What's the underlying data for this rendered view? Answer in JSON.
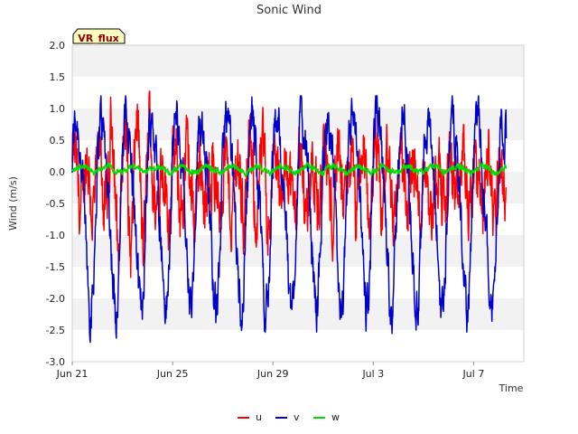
{
  "chart_data": {
    "type": "line",
    "title": "Sonic Wind",
    "badge": "VR_flux",
    "xlabel": "Time",
    "ylabel": "Wind (m/s)",
    "ylim": [
      -3.0,
      2.0
    ],
    "yticks": [
      2.0,
      1.5,
      1.0,
      0.5,
      0.0,
      -0.5,
      -1.0,
      -1.5,
      -2.0,
      -2.5,
      -3.0
    ],
    "ytick_labels": [
      "2.0",
      "1.5",
      "1.0",
      "0.5",
      "0.0",
      "-0.5",
      "-1.0",
      "-1.5",
      "-2.0",
      "-2.5",
      "-3.0"
    ],
    "xlim_days": [
      0,
      18
    ],
    "xticks": [
      {
        "label": "Jun 21",
        "day": 0
      },
      {
        "label": "Jun 25",
        "day": 4
      },
      {
        "label": "Jun 29",
        "day": 8
      },
      {
        "label": "Jul 3",
        "day": 12
      },
      {
        "label": "Jul 7",
        "day": 16
      }
    ],
    "data_end_day": 17.3,
    "grid": "horizontal bands",
    "legend": "bottom-center",
    "series": [
      {
        "name": "u",
        "color": "#ff0000"
      },
      {
        "name": "v",
        "color": "#0000cc"
      },
      {
        "name": "w",
        "color": "#00dd00"
      }
    ]
  }
}
